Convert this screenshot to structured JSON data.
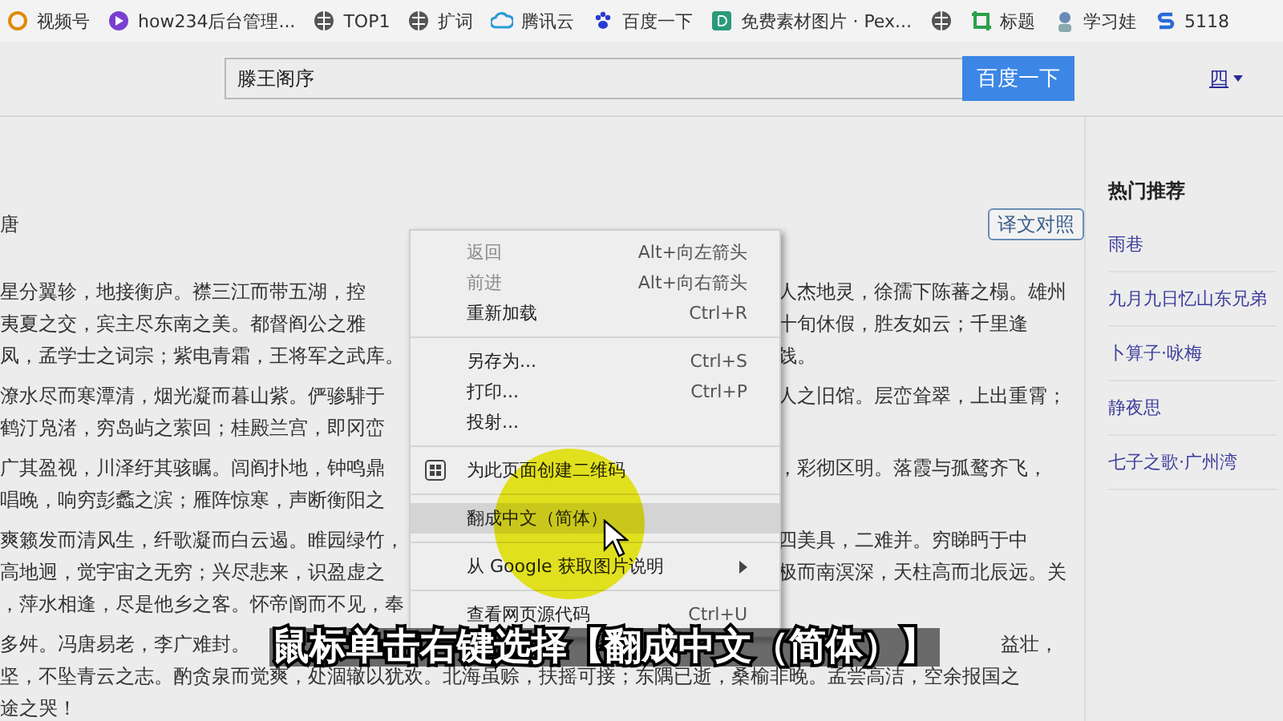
{
  "bookmarks": [
    {
      "kind": "link",
      "label": "视频号"
    },
    {
      "kind": "link",
      "label": "how234后台管理..."
    },
    {
      "kind": "link",
      "label": "TOP1"
    },
    {
      "kind": "link",
      "label": "扩词"
    },
    {
      "kind": "link",
      "label": "腾讯云"
    },
    {
      "kind": "link",
      "label": "百度一下"
    },
    {
      "kind": "link",
      "label": "免费素材图片 · Pex..."
    },
    {
      "kind": "icon"
    },
    {
      "kind": "link",
      "label": "标题"
    },
    {
      "kind": "link",
      "label": "学习娃"
    },
    {
      "kind": "link",
      "label": "5118"
    }
  ],
  "search": {
    "value": "滕王阁序",
    "button": "百度一下",
    "user": "四"
  },
  "article": {
    "author": "唐",
    "compare_button": "译文对照",
    "paragraphs": [
      [
        {
          "kind": "split",
          "left": "星分翼轸，地接衡庐。襟三江而带五湖，控",
          "right": "人杰地灵，徐孺下陈蕃之榻。雄州"
        },
        {
          "kind": "split",
          "left": "夷夏之交，宾主尽东南之美。都督阎公之雅",
          "right": "十旬休假，胜友如云；千里逢"
        },
        {
          "kind": "split",
          "left": "凤，孟学士之词宗；紫电青霜，王将军之武库。",
          "right": "饯。"
        }
      ],
      [
        {
          "kind": "split",
          "left": "潦水尽而寒潭清，烟光凝而暮山紫。俨骖騑于",
          "right": "人之旧馆。层峦耸翠，上出重霄；"
        },
        {
          "kind": "split",
          "left": "鹤汀凫渚，穷岛屿之萦回；桂殿兰宫，即冈峦"
        }
      ],
      [
        {
          "kind": "split",
          "left": "广其盈视，川泽纡其骇瞩。闾阎扑地，钟鸣鼎",
          "right": "，彩彻区明。落霞与孤鹜齐飞，"
        },
        {
          "kind": "split",
          "left": "唱晚，响穷彭蠡之滨；雁阵惊寒，声断衡阳之"
        }
      ],
      [
        {
          "kind": "split",
          "left": "爽籁发而清风生，纤歌凝而白云遏。睢园绿竹，",
          "right": "四美具，二难并。穷睇眄于中"
        },
        {
          "kind": "split",
          "left": "高地迥，觉宇宙之无穷；兴尽悲来，识盈虚之",
          "right": "极而南溟深，天柱高而北辰远。关"
        },
        {
          "kind": "split",
          "left": "，萍水相逢，尽是他乡之客。怀帝阍而不见，奉"
        }
      ],
      [
        {
          "kind": "end",
          "left": "多舛。冯唐易老，李广难封。",
          "right": "益壮，"
        },
        {
          "kind": "full",
          "text": "坚，不坠青云之志。酌贪泉而觉爽，处涸辙以犹欢。北海虽赊，扶摇可接；东隅已逝，桑榆非晚。孟尝高洁，空余报国之"
        },
        {
          "kind": "full",
          "text": "途之哭！"
        }
      ]
    ]
  },
  "sidebar": {
    "title": "热门推荐",
    "items": [
      "雨巷",
      "九月九日忆山东兄弟",
      "卜算子·咏梅",
      "静夜思",
      "七子之歌·广州湾"
    ]
  },
  "context_menu": [
    {
      "kind": "item",
      "label": "返回",
      "shortcut": "Alt+向左箭头",
      "disabled": true,
      "selected": false
    },
    {
      "kind": "item",
      "label": "前进",
      "shortcut": "Alt+向右箭头",
      "disabled": true,
      "selected": false
    },
    {
      "kind": "item",
      "label": "重新加载",
      "shortcut": "Ctrl+R",
      "disabled": false,
      "selected": false
    },
    {
      "kind": "separator"
    },
    {
      "kind": "item",
      "label": "另存为...",
      "shortcut": "Ctrl+S",
      "disabled": false,
      "selected": false
    },
    {
      "kind": "item",
      "label": "打印...",
      "shortcut": "Ctrl+P",
      "disabled": false,
      "selected": false
    },
    {
      "kind": "item",
      "label": "投射...",
      "disabled": false,
      "selected": false
    },
    {
      "kind": "separator"
    },
    {
      "kind": "qr",
      "label": "为此页面创建二维码",
      "disabled": false,
      "selected": false
    },
    {
      "kind": "separator"
    },
    {
      "kind": "item",
      "label": "翻成中文（简体）",
      "disabled": false,
      "selected": true
    },
    {
      "kind": "separator"
    },
    {
      "kind": "submenu",
      "label": "从 Google 获取图片说明",
      "disabled": false,
      "selected": false
    },
    {
      "kind": "separator"
    },
    {
      "kind": "item",
      "label": "查看网页源代码",
      "shortcut": "Ctrl+U",
      "disabled": false,
      "selected": false
    }
  ],
  "caption": "鼠标单击右键选择【翻成中文（简体）】"
}
